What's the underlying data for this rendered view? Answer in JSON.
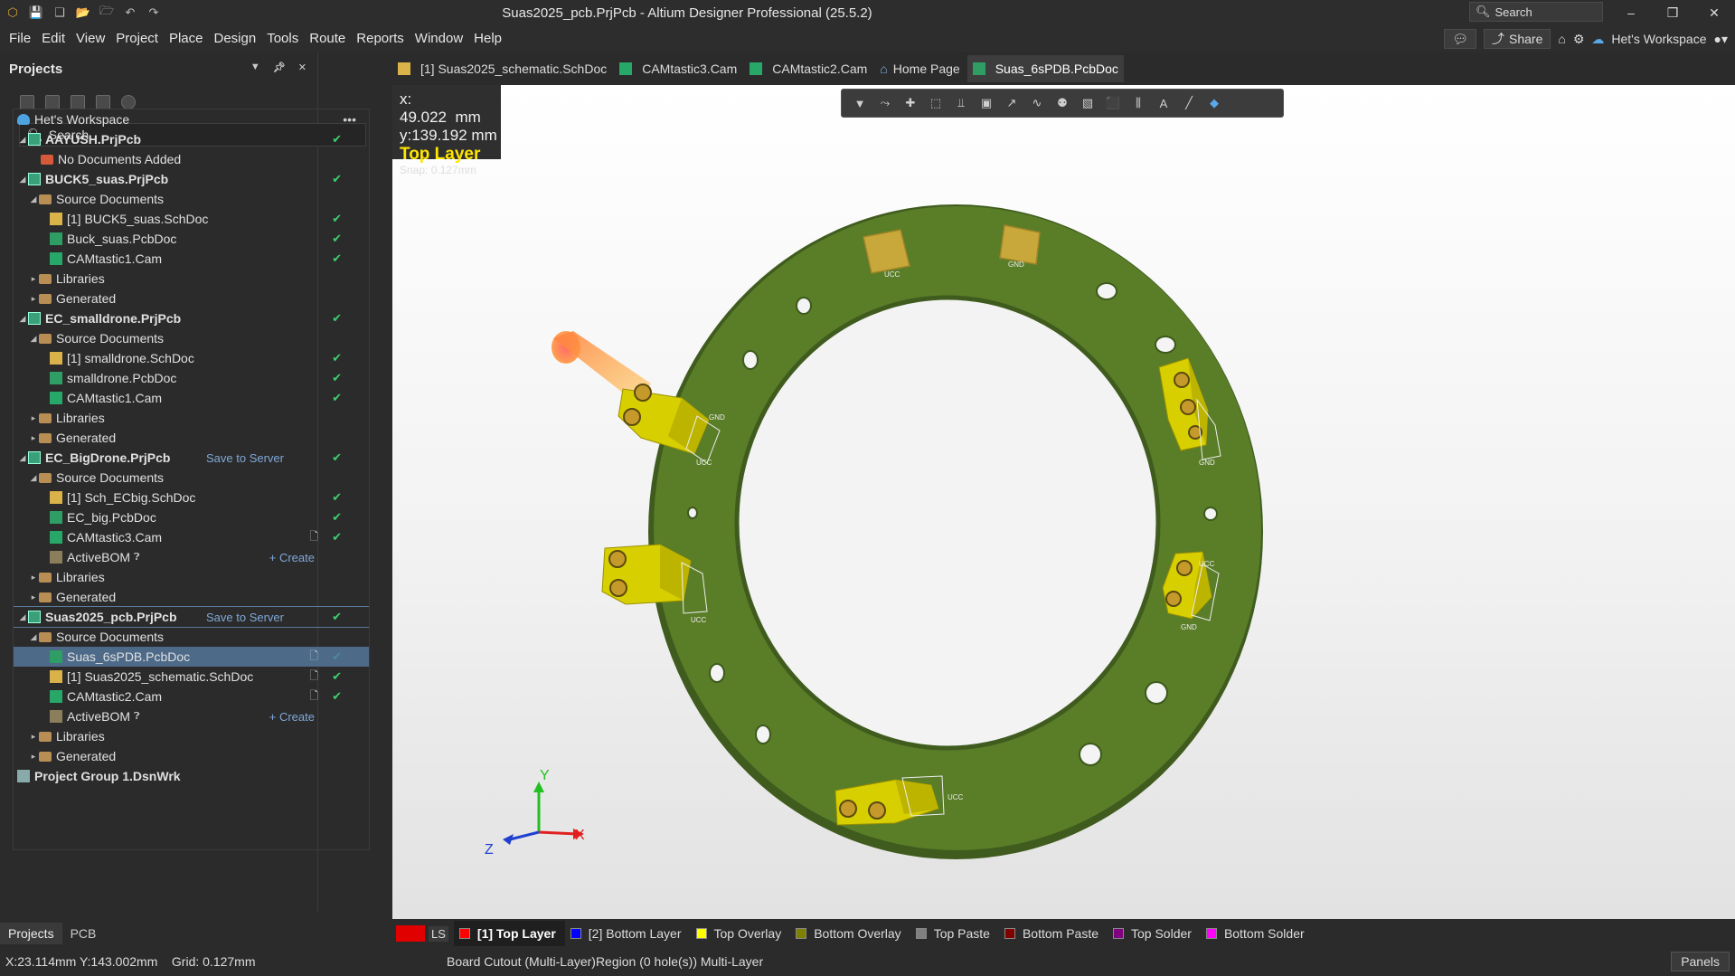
{
  "window": {
    "title": "Suas2025_pcb.PrjPcb - Altium Designer Professional (25.5.2)",
    "search_placeholder": "Search"
  },
  "menu": {
    "items": [
      "File",
      "Edit",
      "View",
      "Project",
      "Place",
      "Design",
      "Tools",
      "Route",
      "Reports",
      "Window",
      "Help"
    ],
    "share_label": "Share",
    "workspace_label": "Het's Workspace"
  },
  "projects_panel": {
    "title": "Projects",
    "search_placeholder": "Search",
    "tree": {
      "workspace": "Het's Workspace",
      "r1": "AAYUSH.PrjPcb",
      "r2": "No Documents Added",
      "r3": "BUCK5_suas.PrjPcb",
      "r4": "Source Documents",
      "r5": "[1] BUCK5_suas.SchDoc",
      "r6": "Buck_suas.PcbDoc",
      "r7": "CAMtastic1.Cam",
      "r8": "Libraries",
      "r9": "Generated",
      "r10": "EC_smalldrone.PrjPcb",
      "r11": "Source Documents",
      "r12": "[1] smalldrone.SchDoc",
      "r13": "smalldrone.PcbDoc",
      "r14": "CAMtastic1.Cam",
      "r15": "Libraries",
      "r16": "Generated",
      "r17": "EC_BigDrone.PrjPcb",
      "r18": "Source Documents",
      "r19": "[1] Sch_ECbig.SchDoc",
      "r20": "EC_big.PcbDoc",
      "r21": "CAMtastic3.Cam",
      "r22": "ActiveBOM",
      "r23": "Libraries",
      "r24": "Generated",
      "r25": "Suas2025_pcb.PrjPcb",
      "r26": "Source Documents",
      "r27": "Suas_6sPDB.PcbDoc",
      "r28": "[1] Suas2025_schematic.SchDoc",
      "r29": "CAMtastic2.Cam",
      "r30": "ActiveBOM",
      "r31": "Libraries",
      "r32": "Generated",
      "r33": "Project Group 1.DsnWrk",
      "save_to_server": "Save to Server",
      "create": "+ Create"
    },
    "bottom_tabs": [
      "Projects",
      "PCB"
    ]
  },
  "doc_tabs": [
    {
      "label": "[1] Suas2025_schematic.SchDoc",
      "icon": "schematic-icon"
    },
    {
      "label": "CAMtastic3.Cam",
      "icon": "cam-icon"
    },
    {
      "label": "CAMtastic2.Cam",
      "icon": "cam-icon"
    },
    {
      "label": "Home Page",
      "icon": "home-icon"
    },
    {
      "label": "Suas_6sPDB.PcbDoc",
      "icon": "pcb-icon"
    }
  ],
  "viewport": {
    "x_readout": "x: 49.022",
    "x_unit": "mm",
    "y_readout": "y:139.192",
    "y_unit": "mm",
    "layer": "Top Layer",
    "snap": "Snap: 0.127mm",
    "axis_x": "X",
    "axis_y": "Y",
    "axis_z": "Z",
    "silk_gnd": "GND",
    "silk_ucc": "UCC"
  },
  "layers": {
    "ls_label": "LS",
    "tabs": [
      {
        "label": "[1] Top Layer",
        "color": "#ff0000"
      },
      {
        "label": "[2] Bottom Layer",
        "color": "#0000ff"
      },
      {
        "label": "Top Overlay",
        "color": "#ffff00"
      },
      {
        "label": "Bottom Overlay",
        "color": "#808000"
      },
      {
        "label": "Top Paste",
        "color": "#808080"
      },
      {
        "label": "Bottom Paste",
        "color": "#800000"
      },
      {
        "label": "Top Solder",
        "color": "#800080"
      },
      {
        "label": "Bottom Solder",
        "color": "#ff00ff"
      }
    ]
  },
  "status": {
    "cursor": "X:23.114mm Y:143.002mm",
    "grid": "Grid: 0.127mm",
    "message": "Board Cutout (Multi-Layer)Region (0 hole(s)) Multi-Layer",
    "panels": "Panels"
  },
  "colors": {
    "board_green": "#5a7d28",
    "connector_yellow": "#e6dc00",
    "pad_gold": "#c9a83b",
    "accent_blue": "#4d6a88"
  }
}
